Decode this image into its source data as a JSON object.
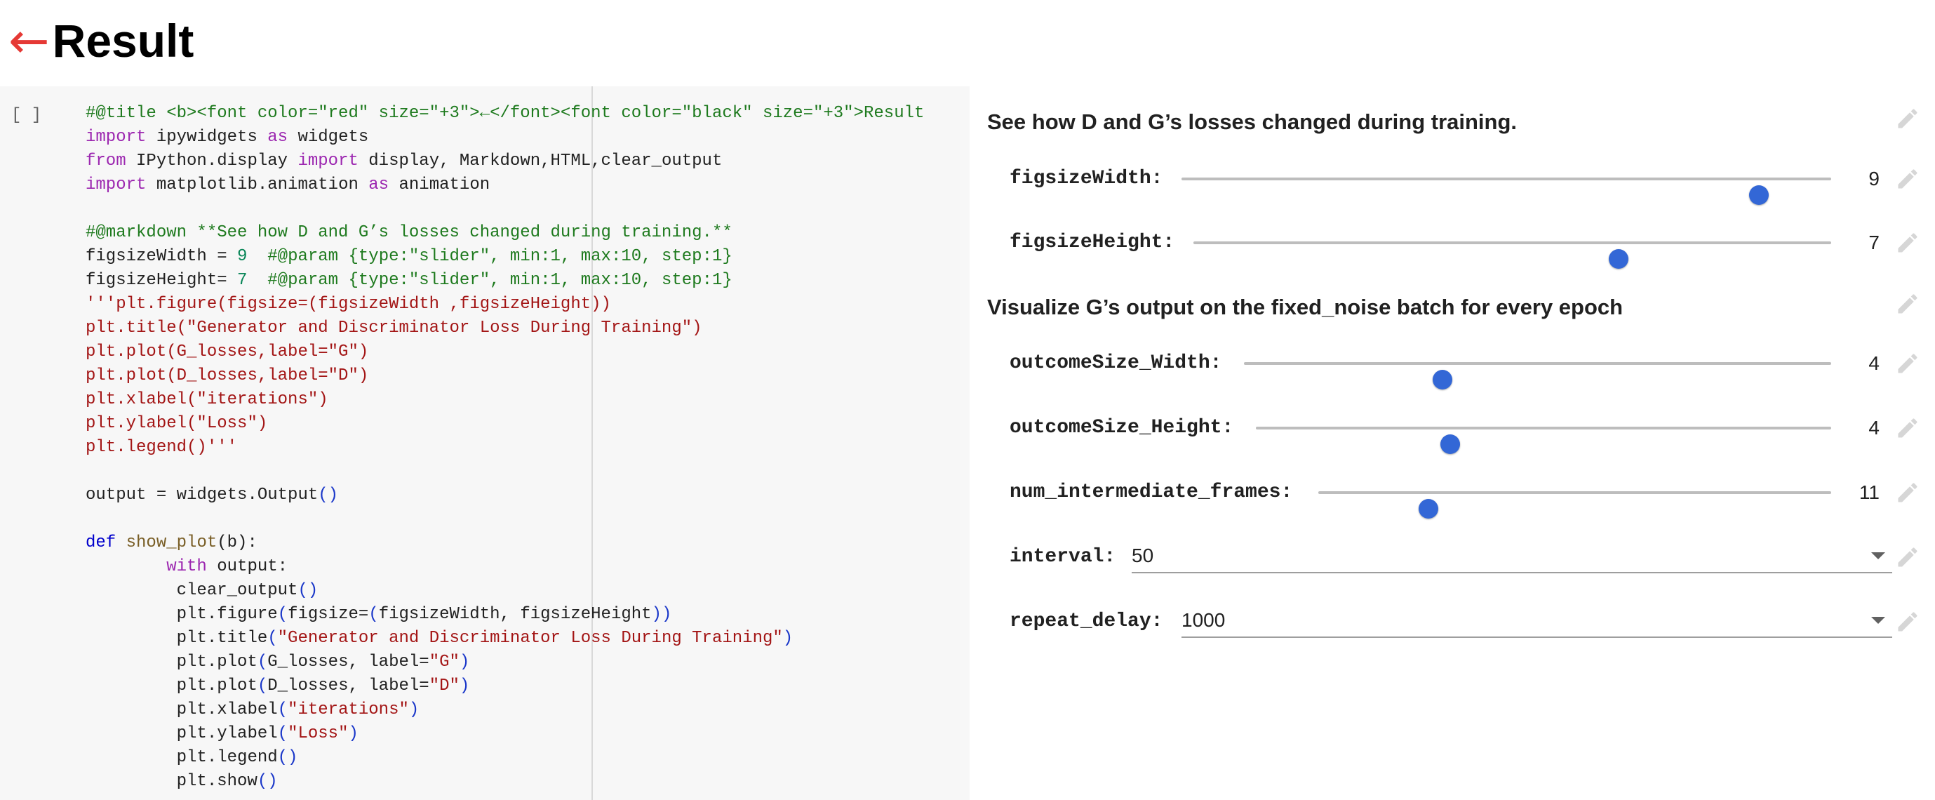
{
  "page": {
    "title_arrow": "←",
    "title": "Result"
  },
  "code": {
    "run_indicator": "[ ]",
    "lines": [
      [
        [
          "c",
          "#@title <b><font color=\"red\" size=\"+3\">←</font><font color=\"black\" size=\"+3\">Result"
        ]
      ],
      [
        [
          "k",
          "import"
        ],
        [
          "",
          " ipywidgets "
        ],
        [
          "k",
          "as"
        ],
        [
          "",
          " widgets"
        ]
      ],
      [
        [
          "k",
          "from"
        ],
        [
          "",
          " IPython.display "
        ],
        [
          "k",
          "import"
        ],
        [
          "",
          " display, Markdown,HTML,clear_output"
        ]
      ],
      [
        [
          "k",
          "import"
        ],
        [
          "",
          " matplotlib.animation "
        ],
        [
          "k",
          "as"
        ],
        [
          "",
          " animation"
        ]
      ],
      [],
      [
        [
          "c",
          "#@markdown **See how D and G’s losses changed during training.**"
        ]
      ],
      [
        [
          "",
          "figsizeWidth = "
        ],
        [
          "n",
          "9"
        ],
        [
          "",
          "  "
        ],
        [
          "c",
          "#@param {type:\"slider\", min:1, max:10, step:1}"
        ]
      ],
      [
        [
          "",
          "figsizeHeight= "
        ],
        [
          "n",
          "7"
        ],
        [
          "",
          "  "
        ],
        [
          "c",
          "#@param {type:\"slider\", min:1, max:10, step:1}"
        ]
      ],
      [
        [
          "s",
          "'''plt.figure(figsize=(figsizeWidth ,figsizeHeight))"
        ]
      ],
      [
        [
          "s",
          "plt.title(\"Generator and Discriminator Loss During Training\")"
        ]
      ],
      [
        [
          "s",
          "plt.plot(G_losses,label=\"G\")"
        ]
      ],
      [
        [
          "s",
          "plt.plot(D_losses,label=\"D\")"
        ]
      ],
      [
        [
          "s",
          "plt.xlabel(\"iterations\")"
        ]
      ],
      [
        [
          "s",
          "plt.ylabel(\"Loss\")"
        ]
      ],
      [
        [
          "s",
          "plt.legend()'''"
        ]
      ],
      [],
      [
        [
          "",
          "output = widgets.Output"
        ],
        [
          "p",
          "()"
        ]
      ],
      [],
      [
        [
          "d",
          "def"
        ],
        [
          "",
          " "
        ],
        [
          "f",
          "show_plot"
        ],
        [
          "",
          "(b):"
        ]
      ],
      [
        [
          "",
          "        "
        ],
        [
          "k",
          "with"
        ],
        [
          "",
          " output:"
        ]
      ],
      [
        [
          "",
          "         clear_output"
        ],
        [
          "p",
          "()"
        ]
      ],
      [
        [
          "",
          "         plt.figure"
        ],
        [
          "p",
          "("
        ],
        [
          "",
          "figsize="
        ],
        [
          "p",
          "("
        ],
        [
          "",
          "figsizeWidth, figsizeHeight"
        ],
        [
          "p",
          "))"
        ]
      ],
      [
        [
          "",
          "         plt.title"
        ],
        [
          "p",
          "("
        ],
        [
          "s",
          "\"Generator and Discriminator Loss During Training\""
        ],
        [
          "p",
          ")"
        ]
      ],
      [
        [
          "",
          "         plt.plot"
        ],
        [
          "p",
          "("
        ],
        [
          "",
          "G_losses, label="
        ],
        [
          "s",
          "\"G\""
        ],
        [
          "p",
          ")"
        ]
      ],
      [
        [
          "",
          "         plt.plot"
        ],
        [
          "p",
          "("
        ],
        [
          "",
          "D_losses, label="
        ],
        [
          "s",
          "\"D\""
        ],
        [
          "p",
          ")"
        ]
      ],
      [
        [
          "",
          "         plt.xlabel"
        ],
        [
          "p",
          "("
        ],
        [
          "s",
          "\"iterations\""
        ],
        [
          "p",
          ")"
        ]
      ],
      [
        [
          "",
          "         plt.ylabel"
        ],
        [
          "p",
          "("
        ],
        [
          "s",
          "\"Loss\""
        ],
        [
          "p",
          ")"
        ]
      ],
      [
        [
          "",
          "         plt.legend"
        ],
        [
          "p",
          "()"
        ]
      ],
      [
        [
          "",
          "         plt.show"
        ],
        [
          "p",
          "()"
        ]
      ]
    ]
  },
  "form": {
    "heading_losses": "See how D and G’s losses changed during training.",
    "heading_output": "Visualize G’s output on the fixed_noise batch for every epoch",
    "figsize_width": {
      "label": "figsizeWidth:",
      "value": "9",
      "fraction": 0.889
    },
    "figsize_height": {
      "label": "figsizeHeight:",
      "value": "7",
      "fraction": 0.667
    },
    "outcome_width": {
      "label": "outcomeSize_Width:",
      "value": "4",
      "fraction": 0.338
    },
    "outcome_height": {
      "label": "outcomeSize_Height:",
      "value": "4",
      "fraction": 0.338
    },
    "num_frames": {
      "label": "num_intermediate_frames:",
      "value": "11",
      "fraction": 0.215
    },
    "interval": {
      "label": "interval:",
      "value": "50"
    },
    "repeat_delay": {
      "label": "repeat_delay:",
      "value": "1000"
    }
  },
  "colors": {
    "title_arrow": "#e53935",
    "slider_thumb": "#3367d6",
    "code_background": "#f7f7f7"
  },
  "icons": {
    "edit": "pencil-icon",
    "dropdown": "chevron-down-icon"
  }
}
